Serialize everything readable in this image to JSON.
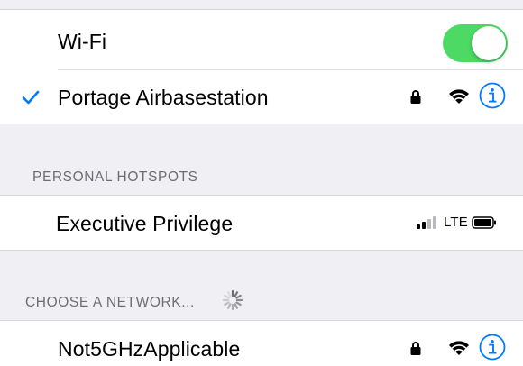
{
  "wifi": {
    "label": "Wi-Fi",
    "enabled": true,
    "toggle_color": "#4cd964"
  },
  "connected_network": {
    "name": "Portage Airbasestation",
    "checkmark_icon": "checkmark-icon",
    "secured": true,
    "signal_icon": "wifi-signal-icon",
    "info_icon": "info-icon",
    "accent_color": "#007aff"
  },
  "personal_hotspots": {
    "header": "PERSONAL HOTSPOTS",
    "items": [
      {
        "name": "Executive Privilege",
        "cell_signal_icon": "cellular-signal-icon",
        "network_type": "LTE",
        "battery_icon": "battery-icon"
      }
    ]
  },
  "choose_network": {
    "header": "CHOOSE A NETWORK...",
    "spinner_icon": "loading-spinner-icon",
    "items": [
      {
        "name": "Not5GHzApplicable",
        "secured": true,
        "signal_icon": "wifi-signal-icon",
        "info_icon": "info-icon"
      }
    ]
  }
}
